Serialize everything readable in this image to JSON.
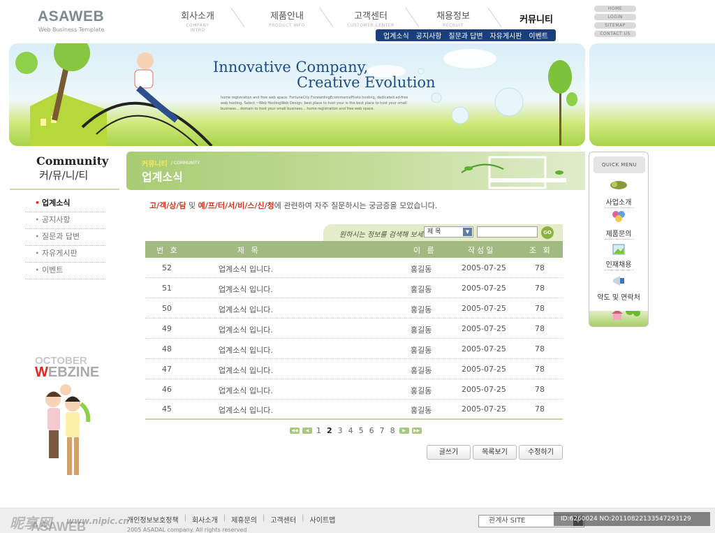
{
  "brand": {
    "name": "ASAWEB",
    "tagline": "Web Business Template"
  },
  "gnb": [
    {
      "ko": "회사소개",
      "en": "COMPANY INTRO"
    },
    {
      "ko": "제품안내",
      "en": "PRODUCT INFO"
    },
    {
      "ko": "고객센터",
      "en": "CUSTOMER CENTER"
    },
    {
      "ko": "채용정보",
      "en": "RECRUIT"
    },
    {
      "ko": "커뮤니티",
      "en": ""
    }
  ],
  "subnav": [
    "업계소식",
    "공지사항",
    "질문과 답변",
    "자유게시판",
    "이벤트"
  ],
  "util_links": [
    "HOME",
    "LOGIN",
    "SITEMAP",
    "CONTACT US"
  ],
  "banner": {
    "title1": "Innovative Company,",
    "title2": "Creative Evolution",
    "desc": "home registration and free web space. FortuneCity ForwardingEcommercePhoto hosting, dedicated ad-free web hosting. Select ~Web HostingWeb Design: best place to host your is the best place to host your small business... domain to host your small business... home registration and free web space."
  },
  "sidebar": {
    "title_en": "Community",
    "title_ko": "커/뮤/니/티",
    "items": [
      "업계소식",
      "공지사항",
      "질문과 답변",
      "자유게시판",
      "이벤트"
    ],
    "webzine_top": "OCTOBER",
    "webzine_w": "W",
    "webzine_rest": "EBZINE"
  },
  "content_head": {
    "sub_ko": "커뮤니티",
    "sub_en": "/ COMMUNITY",
    "title": "업계소식"
  },
  "intro": {
    "red1": "고/객/상/담",
    "mid1": " 및 ",
    "red2": "예/프/터/서/비/스/신/청",
    "rest": "에 관련하여 자주 질문하시는 궁금증을 모았습니다."
  },
  "search": {
    "label": "원하시는 정보를 검색해 보세요!",
    "select_value": "제 목",
    "go": "GO"
  },
  "table": {
    "headers": [
      "번 호",
      "제 목",
      "이 름",
      "작성일",
      "조 회"
    ],
    "rows": [
      {
        "no": "52",
        "title": "업계소식 입니다.",
        "name": "홍길동",
        "date": "2005-07-25",
        "views": "78"
      },
      {
        "no": "51",
        "title": "업계소식 입니다.",
        "name": "홍길동",
        "date": "2005-07-25",
        "views": "78"
      },
      {
        "no": "50",
        "title": "업계소식 입니다.",
        "name": "홍길동",
        "date": "2005-07-25",
        "views": "78"
      },
      {
        "no": "49",
        "title": "업계소식 입니다.",
        "name": "홍길동",
        "date": "2005-07-25",
        "views": "78"
      },
      {
        "no": "48",
        "title": "업계소식 입니다.",
        "name": "홍길동",
        "date": "2005-07-25",
        "views": "78"
      },
      {
        "no": "47",
        "title": "업계소식 입니다.",
        "name": "홍길동",
        "date": "2005-07-25",
        "views": "78"
      },
      {
        "no": "46",
        "title": "업계소식 입니다.",
        "name": "홍길동",
        "date": "2005-07-25",
        "views": "78"
      },
      {
        "no": "45",
        "title": "업계소식 입니다.",
        "name": "홍길동",
        "date": "2005-07-25",
        "views": "78"
      }
    ]
  },
  "pagination": {
    "pages": [
      "1",
      "2",
      "3",
      "4",
      "5",
      "6",
      "7",
      "8"
    ],
    "current": "2"
  },
  "buttons": {
    "write": "글쓰기",
    "list": "목록보기",
    "edit": "수정하기"
  },
  "quick_menu": {
    "title": "QUICK MENU",
    "items": [
      "사업소개",
      "제품문의",
      "인재채용",
      "약도 및 연락처"
    ]
  },
  "footer": {
    "links": [
      "개인정보보호정책",
      "회사소개",
      "제휴문의",
      "고객센터",
      "사이트맵"
    ],
    "copyright": "2005 ASADAL company. All rights reserved",
    "logo": "ASAWEB",
    "family_site": "관계사 SITE"
  },
  "watermark": {
    "site": "昵享网",
    "url": "www.nipic.cn",
    "id": "ID:6260024 NO:20110822133547293129"
  },
  "colors": {
    "navy": "#1a3d7c",
    "green": "#a3b982",
    "red": "#e0281c"
  }
}
